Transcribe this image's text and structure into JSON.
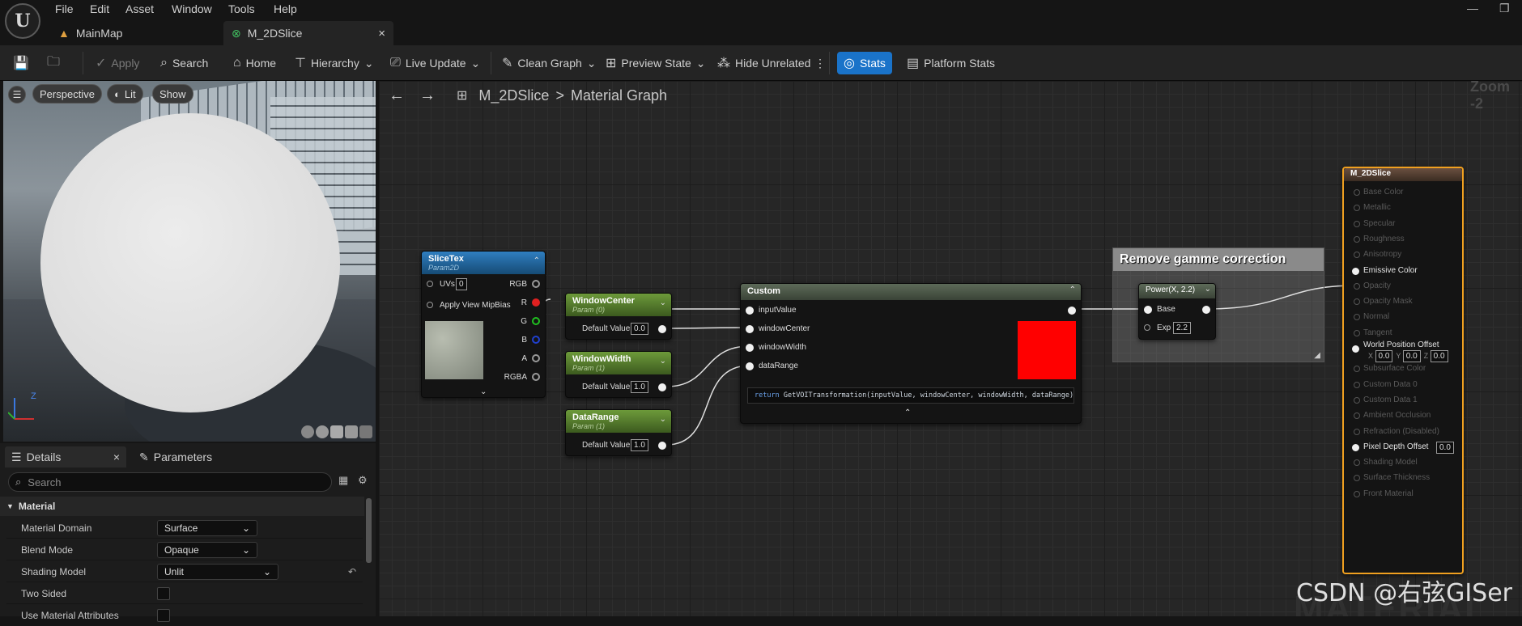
{
  "menu": [
    "File",
    "Edit",
    "Asset",
    "Window",
    "Tools",
    "Help"
  ],
  "tabs": [
    {
      "label": "MainMap"
    },
    {
      "label": "M_2DSlice",
      "close": "×"
    }
  ],
  "toolbar": {
    "apply": "Apply",
    "search": "Search",
    "home": "Home",
    "hierarchy": "Hierarchy",
    "live_update": "Live Update",
    "clean_graph": "Clean Graph",
    "preview_state": "Preview State",
    "hide_unrelated": "Hide Unrelated",
    "stats": "Stats",
    "platform_stats": "Platform Stats",
    "stats_color": "#1a73c9"
  },
  "viewport": {
    "perspective": "Perspective",
    "lit": "Lit",
    "show": "Show",
    "axis_z": "Z"
  },
  "details": {
    "tab_details": "Details",
    "tab_close": "×",
    "tab_parameters": "Parameters",
    "search_placeholder": "Search",
    "section": "Material",
    "rows": [
      {
        "label": "Material Domain",
        "value": "Surface"
      },
      {
        "label": "Blend Mode",
        "value": "Opaque"
      },
      {
        "label": "Shading Model",
        "value": "Unlit"
      },
      {
        "label": "Two Sided",
        "value": ""
      },
      {
        "label": "Use Material Attributes",
        "value": ""
      }
    ]
  },
  "graph": {
    "breadcrumb_root": "M_2DSlice",
    "breadcrumb_sep": ">",
    "breadcrumb_page": "Material Graph",
    "zoom": "Zoom -2",
    "watermark_bg": "MATERIAL",
    "slicetex": {
      "title": "SliceTex",
      "subtitle": "Param2D",
      "uvs": "UVs",
      "uvs_val": "0",
      "mipbias": "Apply View MipBias",
      "outputs": [
        "RGB",
        "R",
        "G",
        "B",
        "A",
        "RGBA"
      ]
    },
    "params": [
      {
        "title": "WindowCenter",
        "subtitle": "Param (0)",
        "label": "Default Value",
        "value": "0.0"
      },
      {
        "title": "WindowWidth",
        "subtitle": "Param (1)",
        "label": "Default Value",
        "value": "1.0"
      },
      {
        "title": "DataRange",
        "subtitle": "Param (1)",
        "label": "Default Value",
        "value": "1.0"
      }
    ],
    "custom": {
      "title": "Custom",
      "inputs": [
        "inputValue",
        "windowCenter",
        "windowWidth",
        "dataRange"
      ],
      "code_keyword": "return",
      "code": " GetVOITransformation(inputValue, windowCenter, windowWidth, dataRange);",
      "preview_color": "#ff0000"
    },
    "comment": "Remove gamme correction",
    "power": {
      "title": "Power(X, 2.2)",
      "base": "Base",
      "exp": "Exp",
      "exp_val": "2.2"
    },
    "material_node": {
      "title": "M_2DSlice",
      "pins": [
        "Base Color",
        "Metallic",
        "Specular",
        "Roughness",
        "Anisotropy",
        "Emissive Color",
        "Opacity",
        "Opacity Mask",
        "Normal",
        "Tangent",
        "World Position Offset",
        "Subsurface Color",
        "Custom Data 0",
        "Custom Data 1",
        "Ambient Occlusion",
        "Refraction (Disabled)",
        "Pixel Depth Offset",
        "Shading Model",
        "Surface Thickness",
        "Front Material"
      ],
      "wpo": {
        "x_label": "X",
        "x": "0.0",
        "y_label": "Y",
        "y": "0.0",
        "z_label": "Z",
        "z": "0.0"
      },
      "pdo_val": "0.0",
      "border_color": "#f0a020"
    }
  },
  "watermark": "CSDN @右弦GISer"
}
